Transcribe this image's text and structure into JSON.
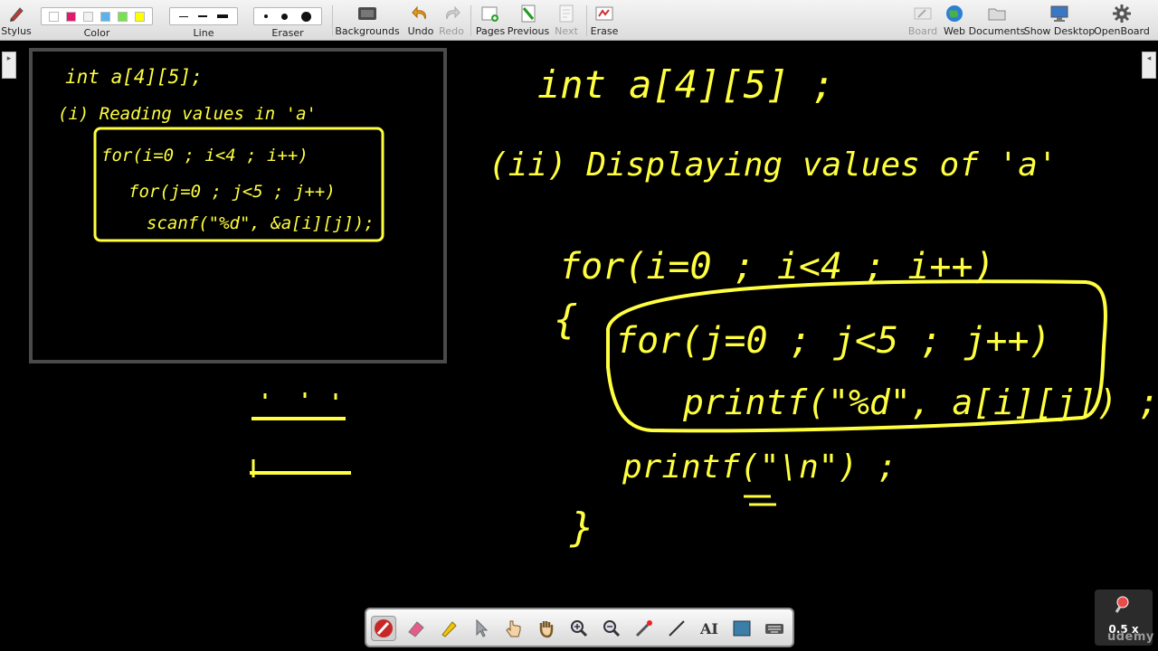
{
  "toolbar": {
    "stylus": "Stylus",
    "color": "Color",
    "line": "Line",
    "eraser": "Eraser",
    "backgrounds": "Backgrounds",
    "undo": "Undo",
    "redo": "Redo",
    "pages": "Pages",
    "previous": "Previous",
    "next": "Next",
    "erase": "Erase",
    "board": "Board",
    "web": "Web",
    "documents": "Documents",
    "show_desktop": "Show Desktop",
    "openboard": "OpenBoard",
    "colors": [
      "#ffffff",
      "#e2196d",
      "#f2f2f2",
      "#5ab3ee",
      "#75e34d",
      "#ffff00"
    ]
  },
  "board": {
    "ink_color": "#ffff40",
    "left_panel": {
      "line1": "int  a[4][5];",
      "line2": "(i)  Reading values in 'a'",
      "code1": "for(i=0 ; i<4 ; i++)",
      "code2": "for(j=0 ; j<5 ; j++)",
      "code3": "scanf(\"%d\", &a[i][j]);"
    },
    "right": {
      "decl": "int  a[4][5] ;",
      "heading": "(ii)  Displaying  values  of 'a'",
      "outer_for": "for(i=0 ; i<4 ; i++)",
      "open_brace": "{",
      "inner_for": "for(j=0 ; j<5 ; j++)",
      "printf1": "printf(\"%d\", a[i][j]) ;",
      "printf2": "printf(\"\\n\") ;",
      "close_brace": "}"
    }
  },
  "zoom": {
    "value": "0.5 x"
  },
  "watermark": "udemy"
}
